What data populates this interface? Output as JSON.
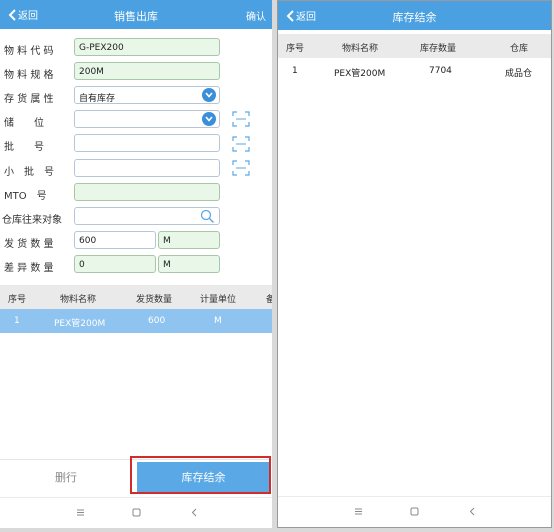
{
  "left": {
    "header": {
      "back": "返回",
      "title": "销售出库",
      "confirm": "确认"
    },
    "form": {
      "material_code": {
        "label": "物 料 代 码",
        "value": "G-PEX200"
      },
      "material_spec": {
        "label": "物 料 规 格",
        "value": "200M"
      },
      "stock_attr": {
        "label": "存 货 属 性",
        "value": "自有库存"
      },
      "storage_location": {
        "label": "储　　位",
        "value": ""
      },
      "batch_no": {
        "label": "批　　号",
        "value": ""
      },
      "sub_batch_no": {
        "label": "小　批　号",
        "value": ""
      },
      "mto_no": {
        "label": "MTO　号",
        "value": ""
      },
      "counterparty": {
        "label": "仓库往来对象",
        "value": ""
      },
      "ship_qty": {
        "label": "发 货 数 量",
        "value": "600",
        "unit": "M"
      },
      "diff_qty": {
        "label": "差 异 数 量",
        "value": "0",
        "unit": "M"
      }
    },
    "table": {
      "headers": [
        "序号",
        "物料名称",
        "发货数量",
        "计量单位",
        "备"
      ],
      "rows": [
        {
          "no": "1",
          "name": "PEX管200M",
          "qty": "600",
          "unit": "M"
        }
      ]
    },
    "actions": {
      "delete": "删行",
      "stock_balance": "库存结余"
    }
  },
  "right": {
    "header": {
      "back": "返回",
      "title": "库存结余"
    },
    "table": {
      "headers": [
        "序号",
        "物料名称",
        "库存数量",
        "仓库"
      ],
      "rows": [
        {
          "no": "1",
          "name": "PEX管200M",
          "qty": "7704",
          "warehouse": "成品仓"
        }
      ]
    }
  },
  "colors": {
    "header": "#4aa0e0",
    "selected_row": "#8fc3f0",
    "button": "#5aa8e6",
    "highlight": "#d32a2a"
  }
}
